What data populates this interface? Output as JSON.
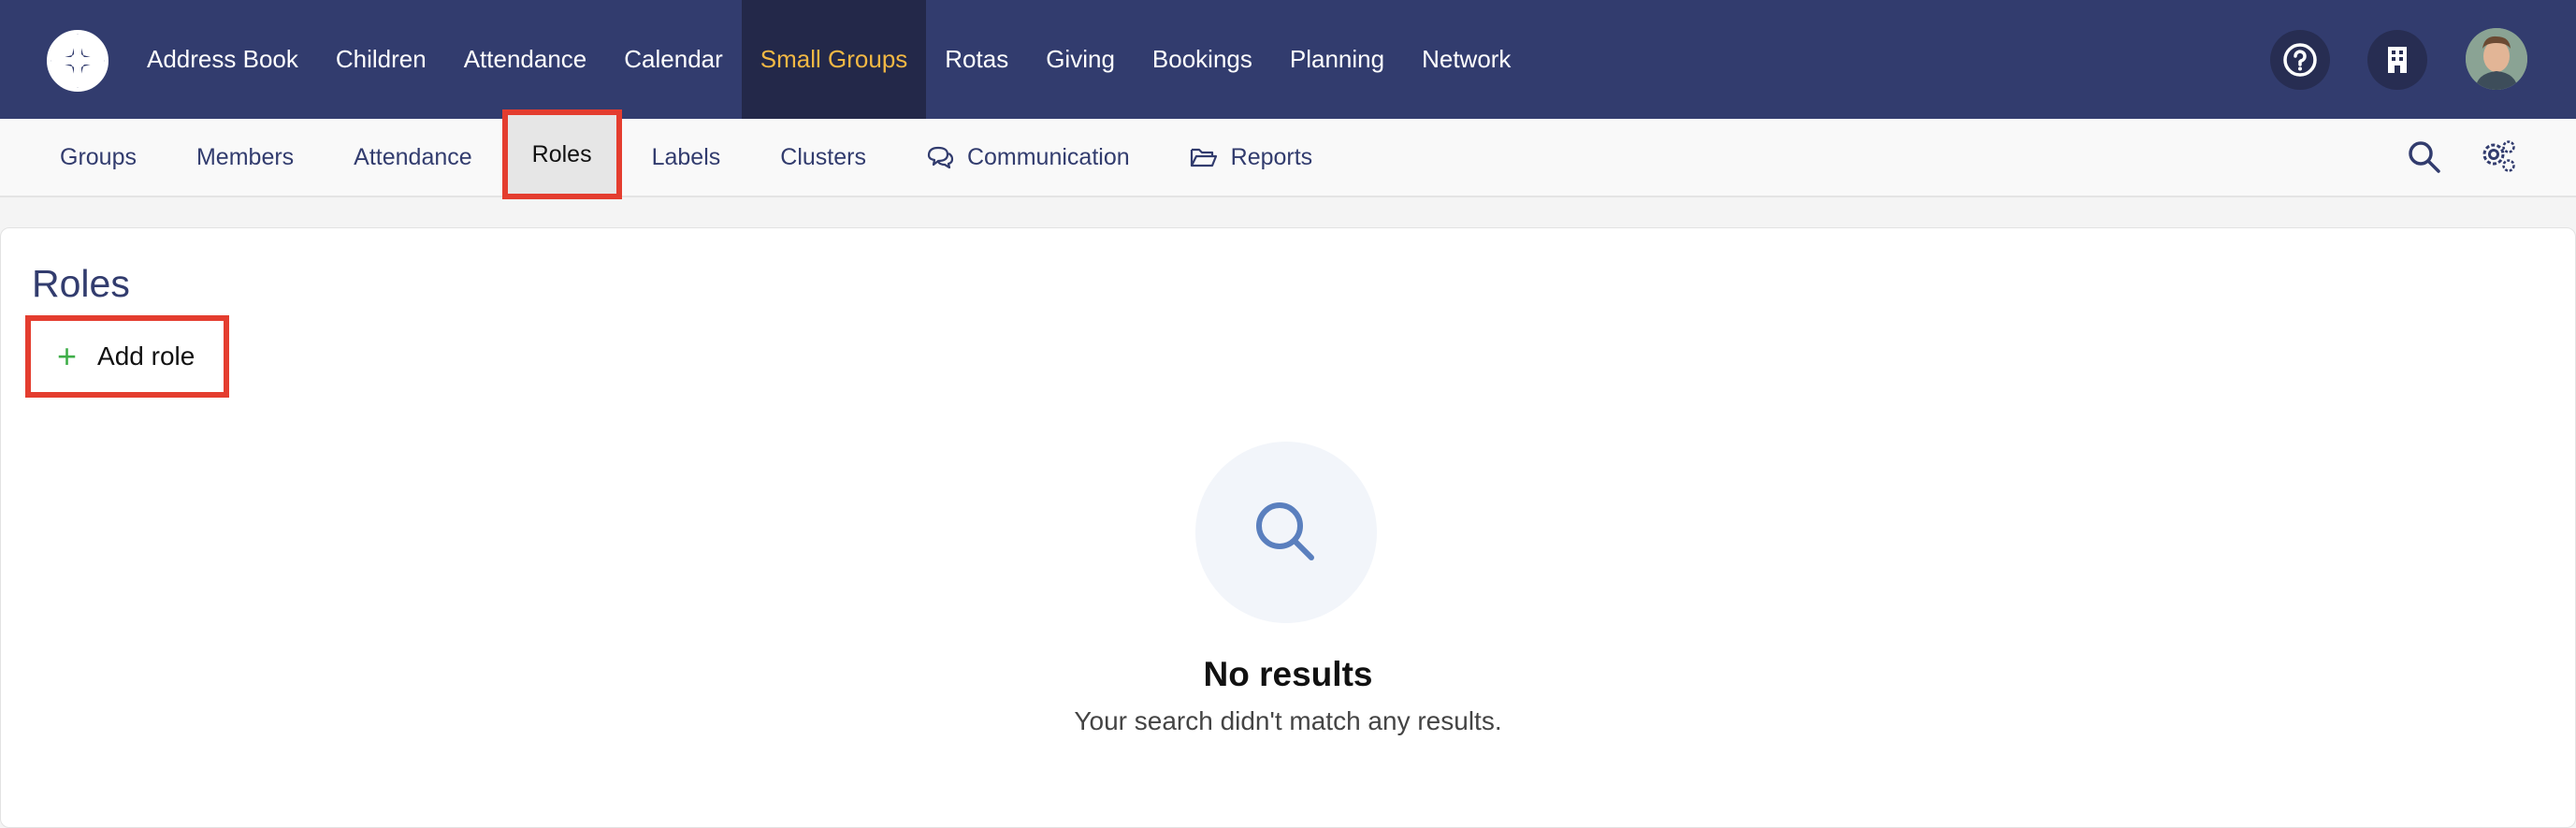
{
  "top_nav": {
    "items": [
      {
        "label": "Address Book"
      },
      {
        "label": "Children"
      },
      {
        "label": "Attendance"
      },
      {
        "label": "Calendar"
      },
      {
        "label": "Small Groups",
        "active": true
      },
      {
        "label": "Rotas"
      },
      {
        "label": "Giving"
      },
      {
        "label": "Bookings"
      },
      {
        "label": "Planning"
      },
      {
        "label": "Network"
      }
    ],
    "icons": [
      "help-icon",
      "building-icon",
      "user-avatar"
    ]
  },
  "sub_nav": {
    "tabs": [
      {
        "label": "Groups"
      },
      {
        "label": "Members"
      },
      {
        "label": "Attendance"
      },
      {
        "label": "Roles",
        "active": true
      },
      {
        "label": "Labels"
      },
      {
        "label": "Clusters"
      },
      {
        "label": "Communication",
        "icon": "chat-icon"
      },
      {
        "label": "Reports",
        "icon": "folder-icon"
      }
    ],
    "right_icons": [
      "search-icon",
      "settings-gears-icon"
    ]
  },
  "page": {
    "title": "Roles",
    "add_button": {
      "icon": "plus-icon",
      "label": "Add role"
    }
  },
  "empty_state": {
    "icon": "search-icon",
    "title": "No results",
    "message": "Your search didn't match any results."
  },
  "colors": {
    "header_bg": "#323c6e",
    "active_top_bg": "#232849",
    "active_top_text": "#f2b844",
    "highlight_border": "#e43d2f",
    "plus_green": "#3fae49"
  }
}
